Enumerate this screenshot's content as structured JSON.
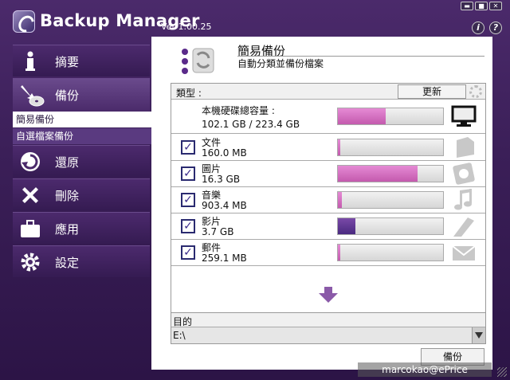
{
  "app": {
    "title": "Backup Manager",
    "version": "Ver 1.00.25"
  },
  "window_buttons": [
    "▬",
    "■",
    "✕"
  ],
  "help_icons": [
    "i",
    "?"
  ],
  "sidebar": {
    "items": [
      {
        "label": "摘要",
        "icon": "info-icon"
      },
      {
        "label": "備份",
        "icon": "backup-disc-icon"
      },
      {
        "label": "還原",
        "icon": "restore-icon"
      },
      {
        "label": "刪除",
        "icon": "delete-icon"
      },
      {
        "label": "應用",
        "icon": "briefcase-icon"
      },
      {
        "label": "設定",
        "icon": "gear-icon"
      }
    ],
    "submenu": [
      "簡易備份",
      "自選檔案備份"
    ]
  },
  "header": {
    "title": "簡易備份",
    "subtitle": "自動分類並備份檔案"
  },
  "grid": {
    "type_label": "類型 :",
    "refresh_label": "更新",
    "disk": {
      "name": "本機硬碟總容量 :",
      "size": "102.1 GB / 223.4 GB",
      "used_fraction": 0.457
    },
    "categories": [
      {
        "name": "文件",
        "size": "160.0 MB",
        "fraction": 0.0,
        "checked": true,
        "icon": "document-icon",
        "dark": false
      },
      {
        "name": "圖片",
        "size": "16.3 GB",
        "fraction": 0.76,
        "checked": true,
        "icon": "photo-icon",
        "dark": false
      },
      {
        "name": "音樂",
        "size": "903.4 MB",
        "fraction": 0.04,
        "checked": true,
        "icon": "music-note-icon",
        "dark": false
      },
      {
        "name": "影片",
        "size": "3.7 GB",
        "fraction": 0.17,
        "checked": true,
        "icon": "video-icon",
        "dark": true
      },
      {
        "name": "郵件",
        "size": "259.1 MB",
        "fraction": 0.01,
        "checked": true,
        "icon": "mail-icon",
        "dark": false
      }
    ]
  },
  "destination": {
    "label": "目的",
    "value": "E:\\"
  },
  "backup_button": "備份",
  "watermark": "marcokao@ePrice",
  "colors": {
    "accent": "#4b2a6b",
    "bar_fill": "#d46ec2",
    "bar_dark": "#5a3590"
  }
}
